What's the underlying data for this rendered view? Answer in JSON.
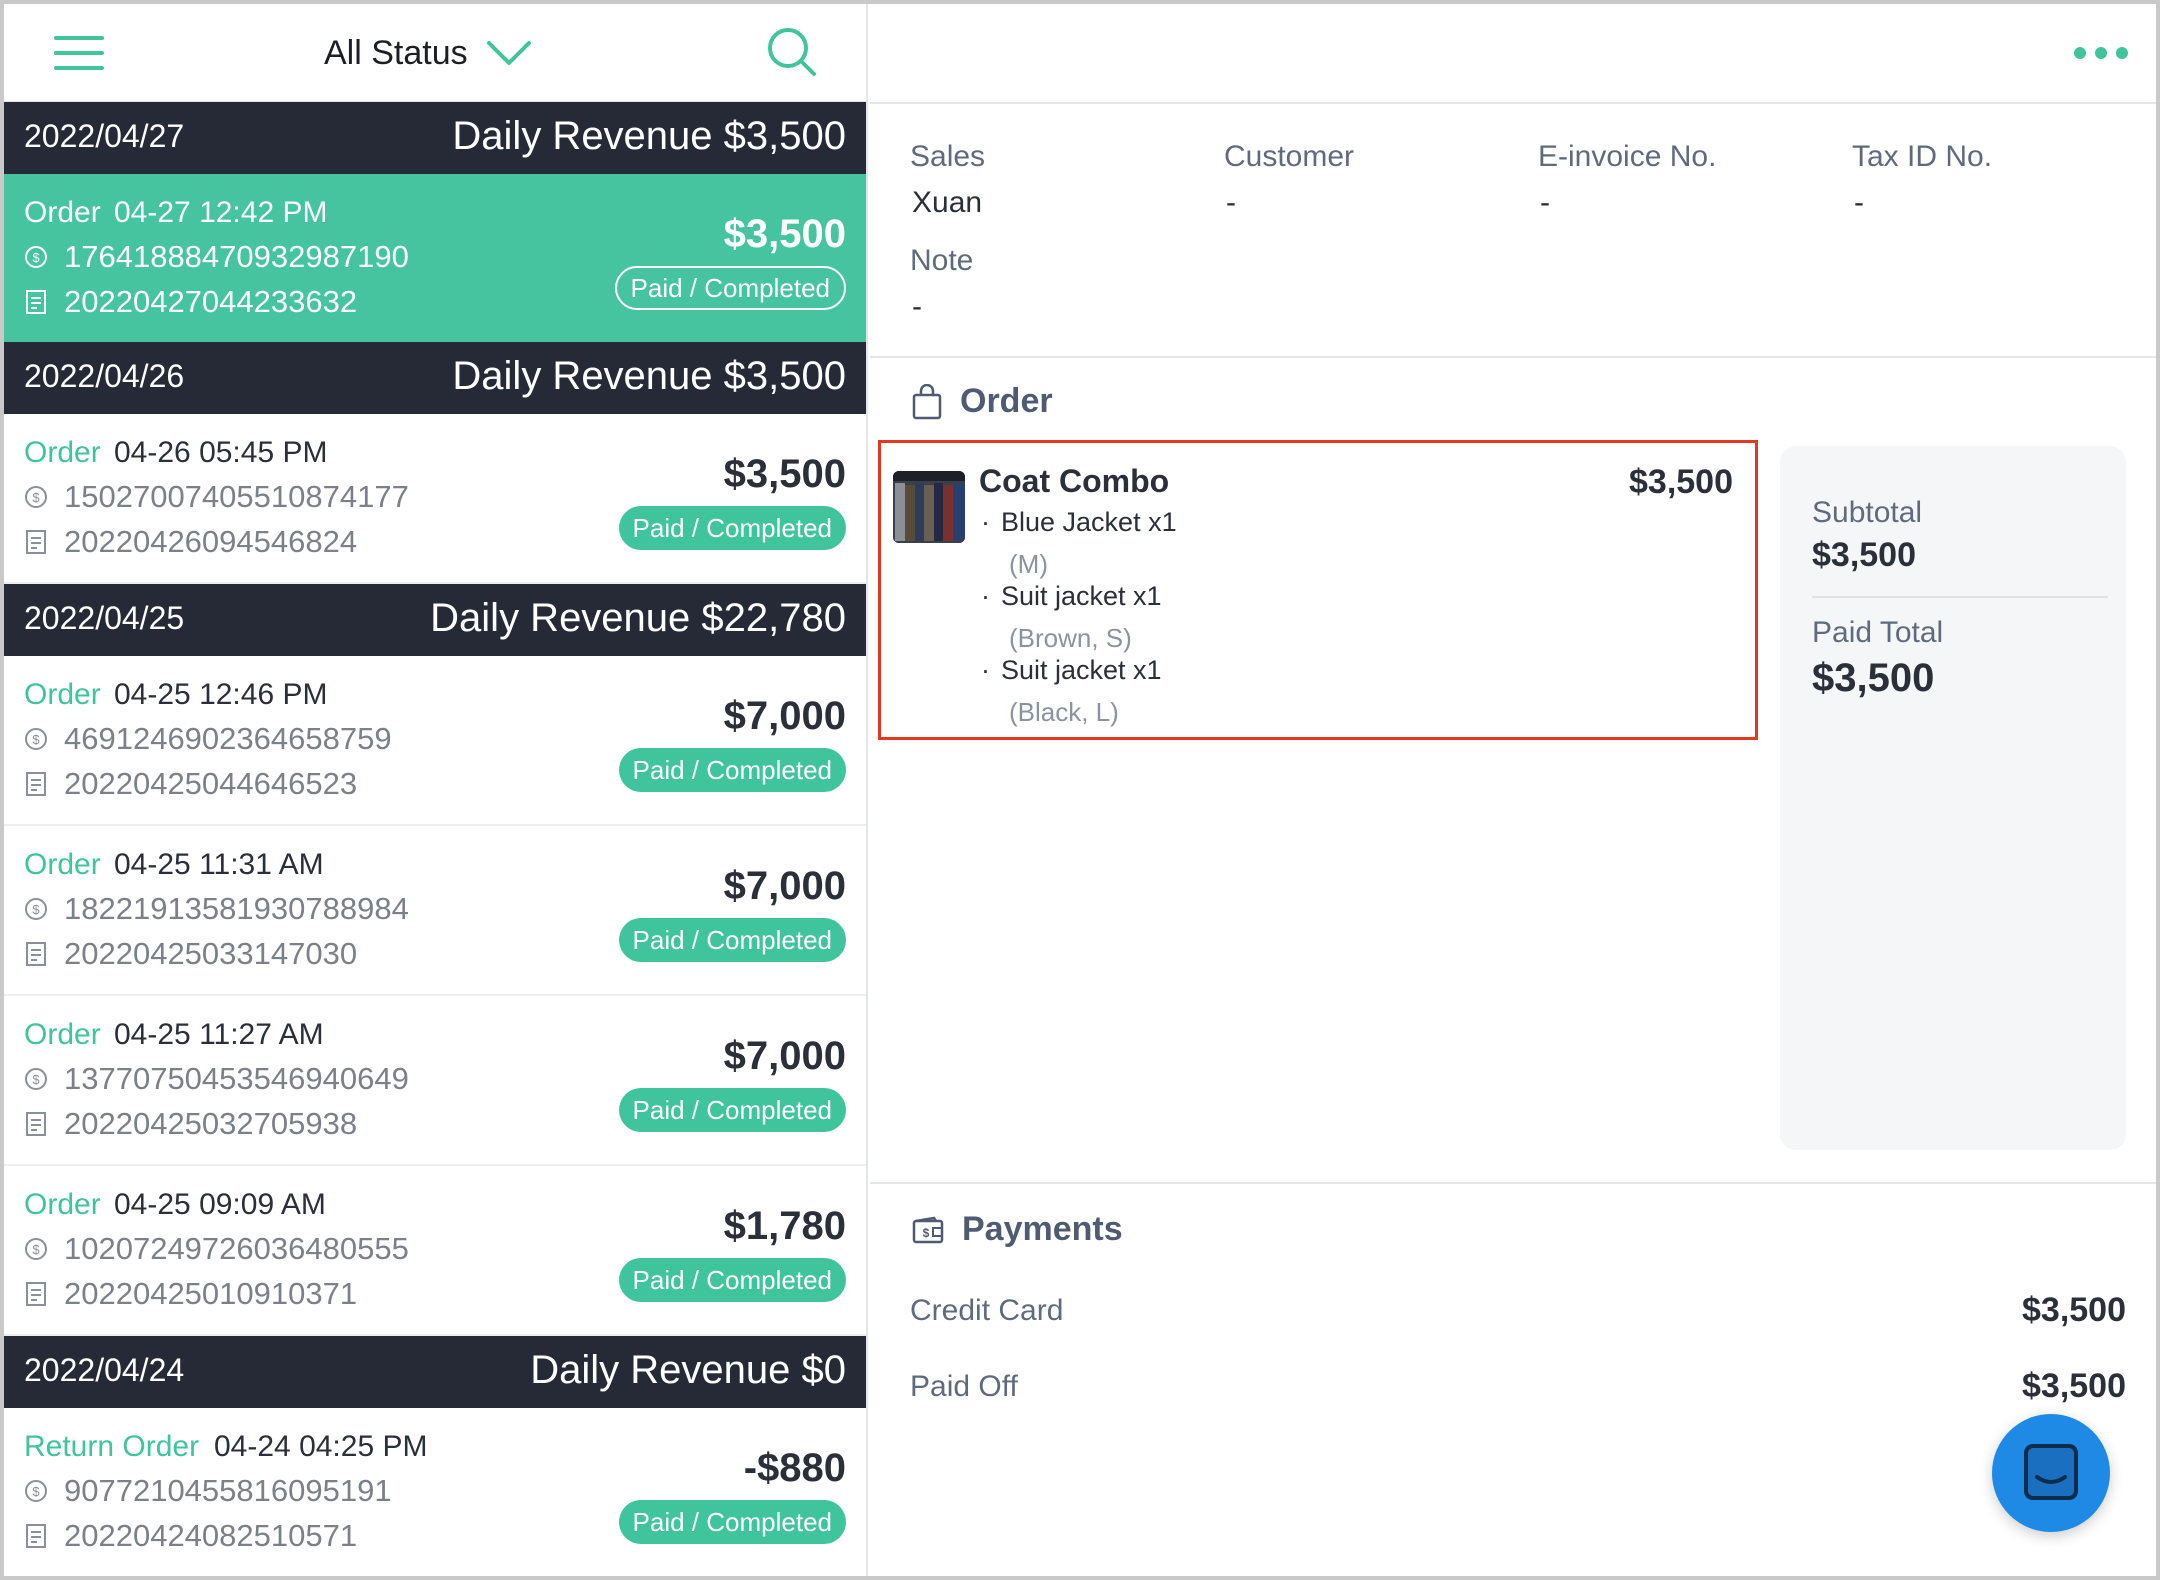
{
  "left_panel": {
    "status_filter_label": "All Status",
    "groups": [
      {
        "date": "2022/04/27",
        "revenue": "Daily Revenue $3,500",
        "orders": [
          {
            "kind": "Order",
            "time": "04-27 12:42 PM",
            "payment_id": "17641888470932987190",
            "receipt_no": "20220427044233632",
            "amount": "$3,500",
            "status": "Paid / Completed"
          }
        ]
      },
      {
        "date": "2022/04/26",
        "revenue": "Daily Revenue $3,500",
        "orders": [
          {
            "kind": "Order",
            "time": "04-26 05:45 PM",
            "payment_id": "15027007405510874177",
            "receipt_no": "20220426094546824",
            "amount": "$3,500",
            "status": "Paid / Completed"
          }
        ]
      },
      {
        "date": "2022/04/25",
        "revenue": "Daily Revenue $22,780",
        "orders": [
          {
            "kind": "Order",
            "time": "04-25 12:46 PM",
            "payment_id": "4691246902364658759",
            "receipt_no": "20220425044646523",
            "amount": "$7,000",
            "status": "Paid / Completed"
          },
          {
            "kind": "Order",
            "time": "04-25 11:31 AM",
            "payment_id": "18221913581930788984",
            "receipt_no": "20220425033147030",
            "amount": "$7,000",
            "status": "Paid / Completed"
          },
          {
            "kind": "Order",
            "time": "04-25 11:27 AM",
            "payment_id": "13770750453546940649",
            "receipt_no": "20220425032705938",
            "amount": "$7,000",
            "status": "Paid / Completed"
          },
          {
            "kind": "Order",
            "time": "04-25 09:09 AM",
            "payment_id": "10207249726036480555",
            "receipt_no": "20220425010910371",
            "amount": "$1,780",
            "status": "Paid / Completed"
          }
        ]
      },
      {
        "date": "2022/04/24",
        "revenue": "Daily Revenue $0",
        "orders": [
          {
            "kind": "Return Order",
            "time": "04-24 04:25 PM",
            "payment_id": "9077210455816095191",
            "receipt_no": "20220424082510571",
            "amount": "-$880",
            "status": "Paid / Completed"
          }
        ]
      }
    ]
  },
  "detail": {
    "info": {
      "sales_label": "Sales",
      "sales_value": "Xuan",
      "customer_label": "Customer",
      "customer_value": "-",
      "einvoice_label": "E-invoice No.",
      "einvoice_value": "-",
      "taxid_label": "Tax ID No.",
      "taxid_value": "-",
      "note_label": "Note",
      "note_value": "-"
    },
    "order_title": "Order",
    "item": {
      "name": "Coat Combo",
      "price": "$3,500",
      "sub_items": [
        {
          "name": "Blue Jacket x1",
          "options": "(M)"
        },
        {
          "name": "Suit jacket x1",
          "options": "(Brown, S)"
        },
        {
          "name": "Suit jacket x1",
          "options": "(Black, L)"
        }
      ]
    },
    "summary": {
      "subtotal_label": "Subtotal",
      "subtotal_value": "$3,500",
      "paid_total_label": "Paid Total",
      "paid_total_value": "$3,500"
    },
    "payments_title": "Payments",
    "payments": [
      {
        "label": "Credit Card",
        "value": "$3,500"
      },
      {
        "label": "Paid Off",
        "value": "$3,500"
      }
    ]
  },
  "colors": {
    "accent": "#40c49c",
    "header_dark": "#262a36",
    "highlight_box": "#e2391e",
    "chat": "#1f8ae6"
  }
}
